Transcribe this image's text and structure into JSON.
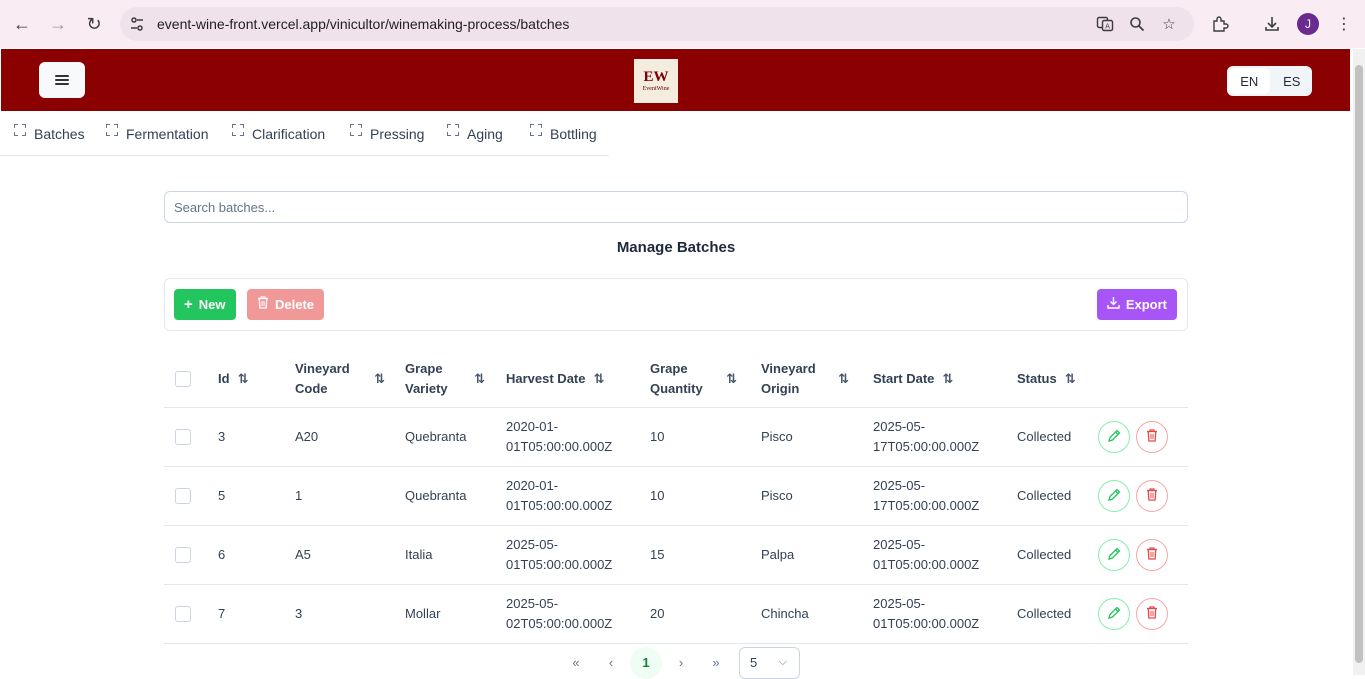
{
  "browser": {
    "url": "event-wine-front.vercel.app/vinicultor/winemaking-process/batches",
    "avatar_letter": "J",
    "icons": [
      "back-icon",
      "forward-icon",
      "reload-icon",
      "site-info-icon",
      "translate-icon",
      "zoom-icon",
      "star-icon",
      "extensions-icon",
      "download-icon",
      "kebab-icon"
    ]
  },
  "header": {
    "logo_mark": "EW",
    "logo_name": "EventWine",
    "lang": [
      "EN",
      "ES"
    ],
    "lang_selected": "EN",
    "colors": {
      "header_bg": "#8b0000"
    }
  },
  "tabs": [
    {
      "label": "Batches"
    },
    {
      "label": "Fermentation"
    },
    {
      "label": "Clarification"
    },
    {
      "label": "Pressing"
    },
    {
      "label": "Aging"
    },
    {
      "label": "Bottling"
    }
  ],
  "search": {
    "placeholder": "Search batches..."
  },
  "page_title": "Manage Batches",
  "toolbar": {
    "new_label": "New",
    "delete_label": "Delete",
    "export_label": "Export",
    "colors": {
      "new": "#22c55e",
      "delete": "#f19999",
      "export": "#a855f7"
    }
  },
  "table": {
    "columns": [
      "Id",
      "Vineyard Code",
      "Grape Variety",
      "Harvest Date",
      "Grape Quantity",
      "Vineyard Origin",
      "Start Date",
      "Status"
    ],
    "rows": [
      {
        "id": "3",
        "vineyard_code": "A20",
        "grape_variety": "Quebranta",
        "harvest_date_1": "2020-01-",
        "harvest_date_2": "01T05:00:00.000Z",
        "grape_quantity": "10",
        "vineyard_origin": "Pisco",
        "start_date_1": "2025-05-",
        "start_date_2": "17T05:00:00.000Z",
        "status": "Collected"
      },
      {
        "id": "5",
        "vineyard_code": "1",
        "grape_variety": "Quebranta",
        "harvest_date_1": "2020-01-",
        "harvest_date_2": "01T05:00:00.000Z",
        "grape_quantity": "10",
        "vineyard_origin": "Pisco",
        "start_date_1": "2025-05-",
        "start_date_2": "17T05:00:00.000Z",
        "status": "Collected"
      },
      {
        "id": "6",
        "vineyard_code": "A5",
        "grape_variety": "Italia",
        "harvest_date_1": "2025-05-",
        "harvest_date_2": "01T05:00:00.000Z",
        "grape_quantity": "15",
        "vineyard_origin": "Palpa",
        "start_date_1": "2025-05-",
        "start_date_2": "01T05:00:00.000Z",
        "status": "Collected"
      },
      {
        "id": "7",
        "vineyard_code": "3",
        "grape_variety": "Mollar",
        "harvest_date_1": "2025-05-",
        "harvest_date_2": "02T05:00:00.000Z",
        "grape_quantity": "20",
        "vineyard_origin": "Chincha",
        "start_date_1": "2025-05-",
        "start_date_2": "01T05:00:00.000Z",
        "status": "Collected"
      }
    ]
  },
  "pagination": {
    "current_page": "1",
    "rows_per_page": "5",
    "icons": [
      "first-page-icon",
      "prev-page-icon",
      "next-page-icon",
      "last-page-icon"
    ]
  }
}
